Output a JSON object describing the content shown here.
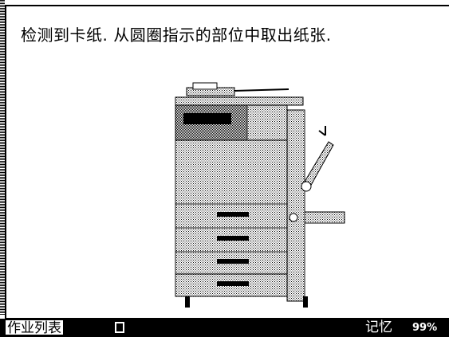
{
  "message": "检测到卡纸. 从圆圈指示的部位中取出纸张.",
  "status_bar": {
    "job_list_label": "作业列表",
    "memory_label": "记忆",
    "memory_value": "99%"
  },
  "illustration": {
    "jam_points": 2,
    "icon": "copier-jam-icon"
  }
}
